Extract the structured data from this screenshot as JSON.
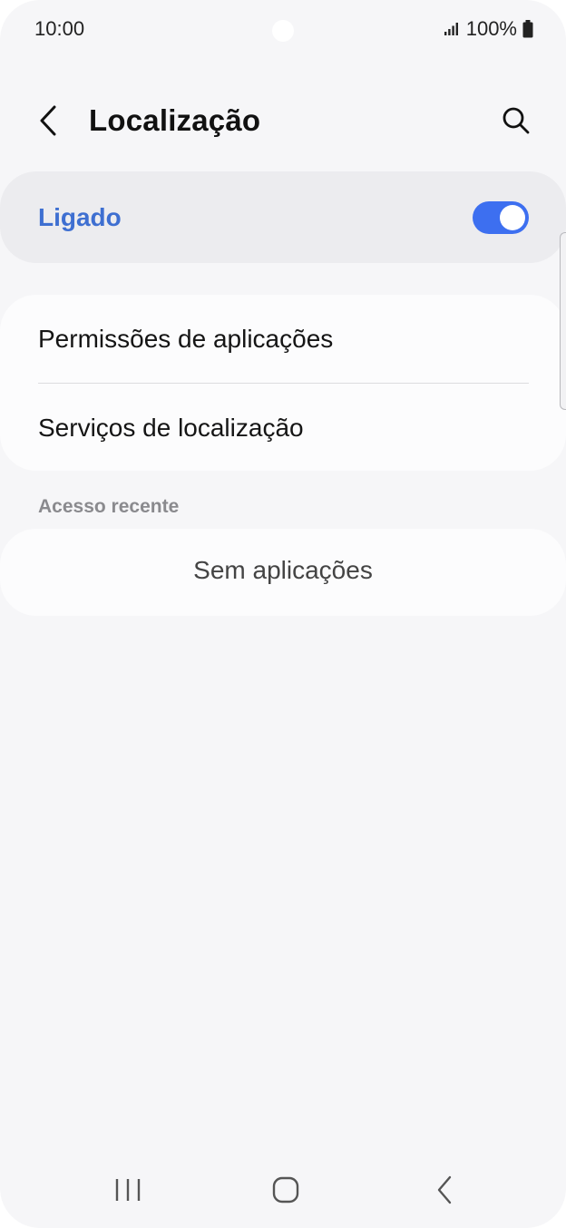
{
  "status_bar": {
    "time": "10:00",
    "battery_percent": "100%",
    "icons": [
      "signal-icon",
      "battery-icon"
    ]
  },
  "header": {
    "title": "Localização",
    "back_icon": "chevron-left-icon",
    "search_icon": "search-icon"
  },
  "master_switch": {
    "label": "Ligado",
    "enabled": true,
    "accent_color": "#3d6ff0"
  },
  "menu": {
    "items": [
      {
        "label": "Permissões de aplicações"
      },
      {
        "label": "Serviços de localização"
      }
    ]
  },
  "recent_access": {
    "header": "Acesso recente",
    "empty_text": "Sem aplicações"
  },
  "nav_bar": {
    "icons": [
      "recents-icon",
      "home-icon",
      "back-icon"
    ]
  }
}
